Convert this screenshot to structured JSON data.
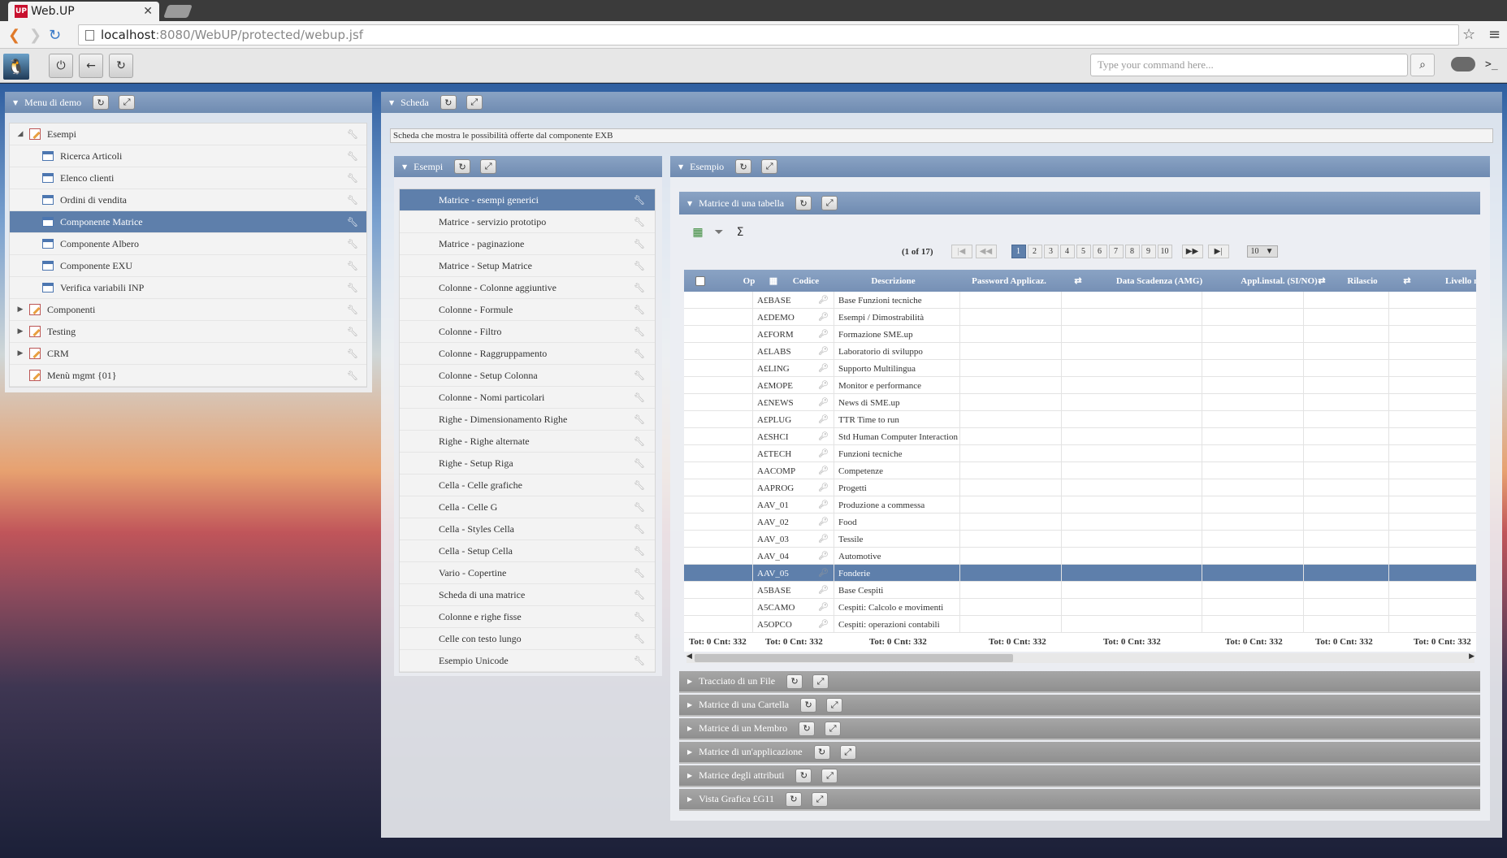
{
  "browser": {
    "tab_title": "Web.UP",
    "tab_favicon": "UP",
    "url_host": "localhost",
    "url_rest": ":8080/WebUP/protected/webup.jsf"
  },
  "toolbar": {
    "command_placeholder": "Type your command here...",
    "term_label": ">_"
  },
  "left_panel": {
    "title": "Menu di demo",
    "items": [
      {
        "label": "Esempi",
        "type": "folder",
        "expanded": true
      },
      {
        "label": "Ricerca Articoli",
        "type": "leaf"
      },
      {
        "label": "Elenco clienti",
        "type": "leaf"
      },
      {
        "label": "Ordini di vendita",
        "type": "leaf"
      },
      {
        "label": "Componente Matrice",
        "type": "leaf",
        "selected": true
      },
      {
        "label": "Componente Albero",
        "type": "leaf"
      },
      {
        "label": "Componente EXU",
        "type": "leaf"
      },
      {
        "label": "Verifica variabili INP",
        "type": "leaf"
      },
      {
        "label": "Componenti",
        "type": "folder"
      },
      {
        "label": "Testing",
        "type": "folder"
      },
      {
        "label": "CRM",
        "type": "folder"
      },
      {
        "label": "Menù mgmt {01}",
        "type": "folder-noexp"
      }
    ]
  },
  "scheda": {
    "title": "Scheda",
    "description": "Scheda che mostra le possibilità offerte dal componente EXB"
  },
  "esempi_panel": {
    "title": "Esempi",
    "items": [
      "Matrice - esempi generici",
      "Matrice - servizio prototipo",
      "Matrice - paginazione",
      "Matrice - Setup Matrice",
      "Colonne - Colonne aggiuntive",
      "Colonne - Formule",
      "Colonne - Filtro",
      "Colonne - Raggruppamento",
      "Colonne - Setup Colonna",
      "Colonne - Nomi particolari",
      "Righe - Dimensionamento Righe",
      "Righe - Righe alternate",
      "Righe - Setup Riga",
      "Cella - Celle grafiche",
      "Cella - Celle G",
      "Cella - Styles Cella",
      "Cella - Setup Cella",
      "Vario - Copertine",
      "Scheda di una matrice",
      "Colonne e righe fisse",
      "Celle con testo lungo",
      "Esempio Unicode"
    ],
    "selected_index": 0
  },
  "esempio_panel": {
    "title": "Esempio",
    "matrix_title": "Matrice di una tabella",
    "pager": {
      "info": "(1 of 17)",
      "first": "|◀",
      "prev": "◀◀",
      "pages": [
        "1",
        "2",
        "3",
        "4",
        "5",
        "6",
        "7",
        "8",
        "9",
        "10"
      ],
      "current": "1",
      "next": "▶▶",
      "last": "▶|",
      "rows_per_page": "10"
    },
    "columns": [
      "Op",
      "Codice",
      "Descrizione",
      "Password Applicaz.",
      "Data Scadenza (AMG)",
      "Appl.instal. (SI/NO)",
      "Rilascio",
      "Livello mod"
    ],
    "rows": [
      {
        "code": "A£BASE",
        "desc": "Base Funzioni tecniche"
      },
      {
        "code": "A£DEMO",
        "desc": "Esempi / Dimostrabilità"
      },
      {
        "code": "A£FORM",
        "desc": "Formazione SME.up"
      },
      {
        "code": "A£LABS",
        "desc": "Laboratorio di sviluppo"
      },
      {
        "code": "A£LING",
        "desc": "Supporto Multilingua"
      },
      {
        "code": "A£MOPE",
        "desc": "Monitor e performance"
      },
      {
        "code": "A£NEWS",
        "desc": "News di SME.up"
      },
      {
        "code": "A£PLUG",
        "desc": "TTR Time to run"
      },
      {
        "code": "A£SHCI",
        "desc": "Std Human Computer Interaction"
      },
      {
        "code": "A£TECH",
        "desc": "Funzioni tecniche"
      },
      {
        "code": "AACOMP",
        "desc": "Competenze"
      },
      {
        "code": "AAPROG",
        "desc": "Progetti"
      },
      {
        "code": "AAV_01",
        "desc": "Produzione a commessa"
      },
      {
        "code": "AAV_02",
        "desc": "Food"
      },
      {
        "code": "AAV_03",
        "desc": "Tessile"
      },
      {
        "code": "AAV_04",
        "desc": "Automotive"
      },
      {
        "code": "AAV_05",
        "desc": "Fonderie",
        "selected": true
      },
      {
        "code": "A5BASE",
        "desc": "Base Cespiti"
      },
      {
        "code": "A5CAMO",
        "desc": "Cespiti: Calcolo e movimenti"
      },
      {
        "code": "A5OPCO",
        "desc": "Cespiti: operazioni contabili"
      }
    ],
    "footer": [
      "Tot: 0 Cnt: 332",
      "Tot: 0 Cnt: 332",
      "Tot: 0 Cnt: 332",
      "Tot: 0 Cnt: 332",
      "Tot: 0 Cnt: 332",
      "Tot: 0 Cnt: 332",
      "Tot: 0 Cnt: 332",
      "Tot: 0 Cnt: 332"
    ],
    "sections": [
      "Tracciato di un File",
      "Matrice di una Cartella",
      "Matrice di un Membro",
      "Matrice di un'applicazione",
      "Matrice degli attributi",
      "Vista Grafica £G11"
    ]
  }
}
